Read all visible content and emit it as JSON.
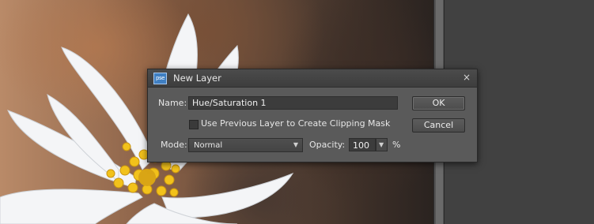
{
  "dialog": {
    "title": "New Layer",
    "app_icon_text": "pse",
    "close_glyph": "×",
    "name_label": "Name:",
    "name_value": "Hue/Saturation 1",
    "clip_checkbox_label": "Use Previous Layer to Create Clipping Mask",
    "clip_checked": false,
    "mode_label": "Mode:",
    "mode_value": "Normal",
    "opacity_label": "Opacity:",
    "opacity_value": "100",
    "opacity_unit": "%",
    "ok_label": "OK",
    "cancel_label": "Cancel"
  },
  "icons": {
    "close": "close-icon",
    "dropdown": "chevron-down-icon",
    "app": "photoshop-elements-icon"
  },
  "colors": {
    "dialog_bg": "#5a5a5a",
    "titlebar_bg": "#444444",
    "field_bg": "#3c3c3c",
    "app_icon": "#3f7fc2"
  }
}
